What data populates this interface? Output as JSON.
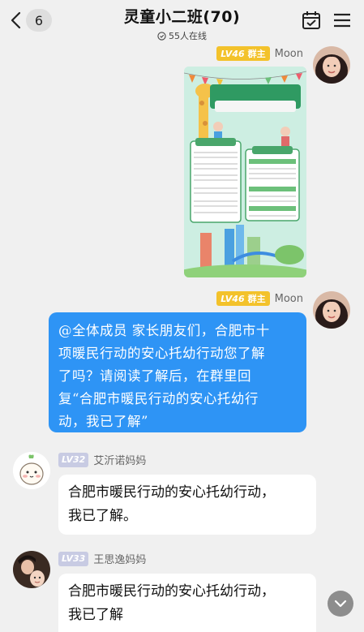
{
  "header": {
    "back_count": "6",
    "title": "灵童小二班(70)",
    "online_text": "55人在线"
  },
  "messages": [
    {
      "sender": "Moon",
      "level": "LV46",
      "role": "群主",
      "type": "image",
      "poster": {
        "headline_1": "合肥市10项暖民行动之",
        "headline_2": "安心托幼行动",
        "box_left_title": "目标任务",
        "box_right_title": "工作措施"
      }
    },
    {
      "sender": "Moon",
      "level": "LV46",
      "role": "群主",
      "type": "text",
      "lines": [
        "@全体成员 家长朋友们，合肥市十",
        "项暖民行动的安心托幼行动您了解",
        "了吗？请阅读了解后，在群里回",
        "复“合肥市暖民行动的安心托幼行",
        "动，我已了解”"
      ]
    },
    {
      "sender": "艾沂诺妈妈",
      "level": "LV32",
      "type": "text",
      "lines": [
        "合肥市暖民行动的安心托幼行动，",
        "我已了解。"
      ]
    },
    {
      "sender": "王思逸妈妈",
      "level": "LV33",
      "type": "text",
      "lines": [
        "合肥市暖民行动的安心托幼行动，",
        "我已了解"
      ]
    }
  ],
  "icons": {
    "back": "chevron-left-icon",
    "online": "clock-icon",
    "calendar": "calendar-check-icon",
    "menu": "hamburger-menu-icon",
    "scroll": "chevron-down-icon"
  },
  "colors": {
    "background": "#f0f0f0",
    "bubble_self": "#2e94f5",
    "owner_badge": "#f3c22b",
    "member_badge": "#c8cbe3"
  }
}
